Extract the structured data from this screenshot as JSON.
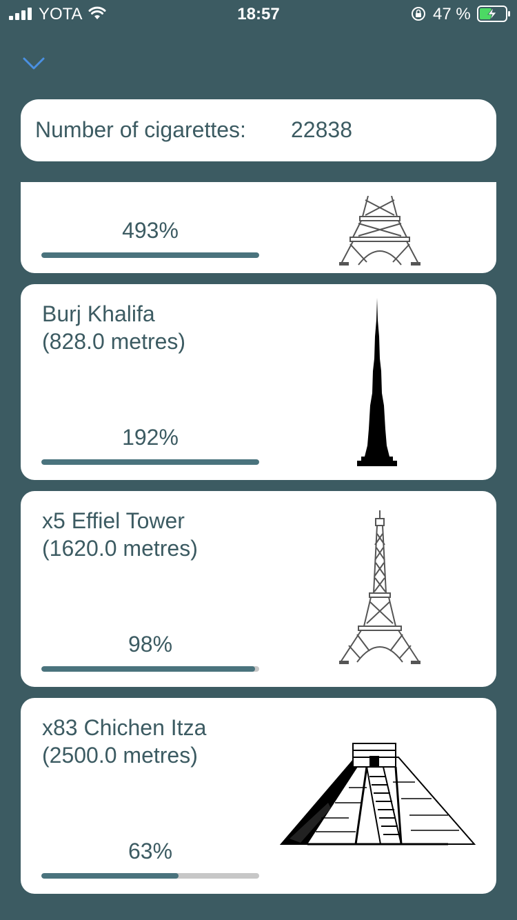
{
  "status_bar": {
    "carrier": "YOTA",
    "time": "18:57",
    "battery_percent": "47 %",
    "battery_level": 0.47
  },
  "header": {
    "collapse_icon": "chevron-down-icon",
    "accent_color": "#4a90e2"
  },
  "summary": {
    "label": "Number of cigarettes:",
    "value": "22838"
  },
  "landmarks": [
    {
      "name": "",
      "height": "",
      "percent": "493%",
      "progress": 1.0,
      "image": "eiffel-tower-icon"
    },
    {
      "name": "Burj Khalifa",
      "height": "(828.0 metres)",
      "percent": "192%",
      "progress": 1.0,
      "image": "burj-khalifa-icon"
    },
    {
      "name": "x5 Effiel Tower",
      "height": "(1620.0 metres)",
      "percent": "98%",
      "progress": 0.98,
      "image": "eiffel-tower-icon"
    },
    {
      "name": "x83 Chichen Itza",
      "height": "(2500.0 metres)",
      "percent": "63%",
      "progress": 0.63,
      "image": "chichen-itza-icon"
    }
  ],
  "colors": {
    "background": "#3c5b62",
    "card": "#ffffff",
    "text": "#3c5b62",
    "progress_fill": "#4a737d",
    "progress_track": "#c7c7c7",
    "battery_charging": "#4cd964"
  }
}
